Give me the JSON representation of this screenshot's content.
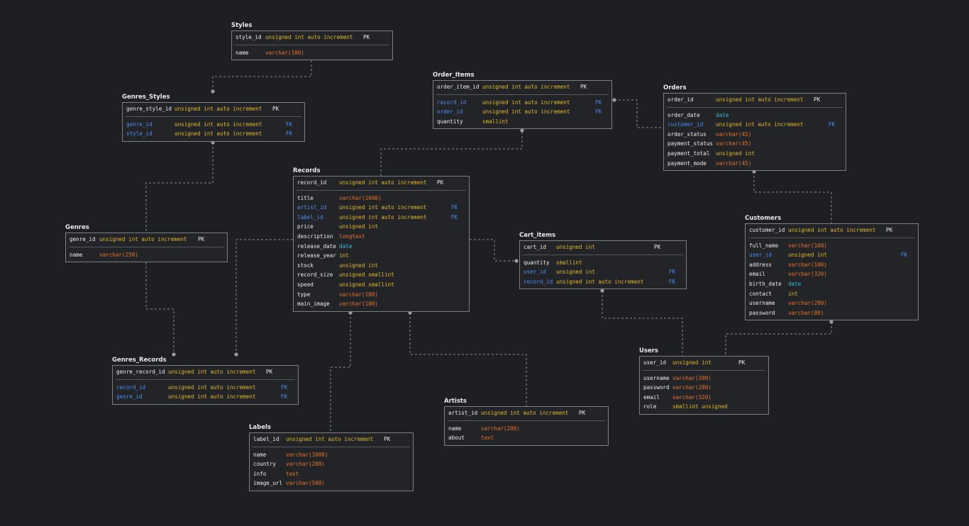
{
  "tables": [
    {
      "id": "styles",
      "name": "Styles",
      "rows": [
        {
          "name": "style_id",
          "type": "unsigned int auto increment",
          "key": "PK",
          "t": "yel",
          "k": "pk"
        },
        {
          "sep": true
        },
        {
          "name": "name",
          "type": "varchar(100)",
          "key": "",
          "t": "ora",
          "k": "reg"
        }
      ]
    },
    {
      "id": "genres_styles",
      "name": "Genres_Styles",
      "rows": [
        {
          "name": "genre_style_id",
          "type": "unsigned int auto increment",
          "key": "PK",
          "t": "yel",
          "k": "pk"
        },
        {
          "sep": true
        },
        {
          "name": "genre_id",
          "type": "unsigned int auto increment",
          "key": "FK",
          "t": "yel",
          "k": "fk"
        },
        {
          "name": "style_id",
          "type": "unsigned int auto increment",
          "key": "FK",
          "t": "yel",
          "k": "fk"
        }
      ]
    },
    {
      "id": "genres",
      "name": "Genres",
      "rows": [
        {
          "name": "genre_id",
          "type": "unsigned int auto increment",
          "key": "PK",
          "t": "yel",
          "k": "pk"
        },
        {
          "sep": true
        },
        {
          "name": "name",
          "type": "varchar(250)",
          "key": "",
          "t": "ora",
          "k": "reg"
        }
      ]
    },
    {
      "id": "genres_records",
      "name": "Genres_Records",
      "rows": [
        {
          "name": "genre_record_id",
          "type": "unsigned int auto increment",
          "key": "PK",
          "t": "yel",
          "k": "pk"
        },
        {
          "sep": true
        },
        {
          "name": "record_id",
          "type": "unsigned int auto increment",
          "key": "FK",
          "t": "yel",
          "k": "fk"
        },
        {
          "name": "genre_id",
          "type": "unsigned int auto increment",
          "key": "FK",
          "t": "yel",
          "k": "fk"
        }
      ]
    },
    {
      "id": "records",
      "name": "Records",
      "rows": [
        {
          "name": "record_id",
          "type": "unsigned int auto increment",
          "key": "PK",
          "t": "yel",
          "k": "pk"
        },
        {
          "sep": true
        },
        {
          "name": "title",
          "type": "varchar(1000)",
          "key": "",
          "t": "ora",
          "k": "reg"
        },
        {
          "name": "artist_id",
          "type": "unsigned int auto increment",
          "key": "FK",
          "t": "yel",
          "k": "fk"
        },
        {
          "name": "label_id",
          "type": "unsigned int auto increment",
          "key": "FK",
          "t": "yel",
          "k": "fk"
        },
        {
          "name": "price",
          "type": "unsigned int",
          "key": "",
          "t": "yel",
          "k": "reg"
        },
        {
          "name": "description",
          "type": "longtext",
          "key": "",
          "t": "ora",
          "k": "reg"
        },
        {
          "name": "release_date",
          "type": "date",
          "key": "",
          "t": "cya",
          "k": "reg"
        },
        {
          "name": "release_year",
          "type": "int",
          "key": "",
          "t": "yel",
          "k": "reg"
        },
        {
          "name": "stock",
          "type": "unsigned int",
          "key": "",
          "t": "yel",
          "k": "reg"
        },
        {
          "name": "record_size",
          "type": "unsigned smallint",
          "key": "",
          "t": "yel",
          "k": "reg"
        },
        {
          "name": "speed",
          "type": "unsigned smallint",
          "key": "",
          "t": "yel",
          "k": "reg"
        },
        {
          "name": "type",
          "type": "varchar(100)",
          "key": "",
          "t": "ora",
          "k": "reg"
        },
        {
          "name": "main_image",
          "type": "varchar(100)",
          "key": "",
          "t": "ora",
          "k": "reg"
        }
      ]
    },
    {
      "id": "labels",
      "name": "Labels",
      "rows": [
        {
          "name": "label_id",
          "type": "unsigned int auto increment",
          "key": "PK",
          "t": "yel",
          "k": "pk"
        },
        {
          "sep": true
        },
        {
          "name": "name",
          "type": "varchar(1000)",
          "key": "",
          "t": "ora",
          "k": "reg"
        },
        {
          "name": "country",
          "type": "varchar(200)",
          "key": "",
          "t": "ora",
          "k": "reg"
        },
        {
          "name": "info",
          "type": "text",
          "key": "",
          "t": "ora",
          "k": "reg"
        },
        {
          "name": "image_url",
          "type": "varchar(500)",
          "key": "",
          "t": "ora",
          "k": "reg"
        }
      ]
    },
    {
      "id": "artists",
      "name": "Artists",
      "rows": [
        {
          "name": "artist_id",
          "type": "unsigned int auto increment",
          "key": "PK",
          "t": "yel",
          "k": "pk"
        },
        {
          "sep": true
        },
        {
          "name": "name",
          "type": "varchar(200)",
          "key": "",
          "t": "ora",
          "k": "reg"
        },
        {
          "name": "about",
          "type": "text",
          "key": "",
          "t": "ora",
          "k": "reg"
        }
      ]
    },
    {
      "id": "order_items",
      "name": "Order_Items",
      "rows": [
        {
          "name": "order_item_id",
          "type": "unsigned int auto increment",
          "key": "PK",
          "t": "yel",
          "k": "pk"
        },
        {
          "sep": true
        },
        {
          "name": "record_id",
          "type": "unsigned int auto increment",
          "key": "FK",
          "t": "yel",
          "k": "fk"
        },
        {
          "name": "order_id",
          "type": "unsigned int auto increment",
          "key": "FK",
          "t": "yel",
          "k": "fk"
        },
        {
          "name": "quantity",
          "type": "smallint",
          "key": "",
          "t": "yel",
          "k": "reg"
        }
      ]
    },
    {
      "id": "orders",
      "name": "Orders",
      "rows": [
        {
          "name": "order_id",
          "type": "unsigned int auto increment",
          "key": "PK",
          "t": "yel",
          "k": "pk"
        },
        {
          "sep": true
        },
        {
          "name": "order_date",
          "type": "date",
          "key": "",
          "t": "cya",
          "k": "reg"
        },
        {
          "name": "customer_id",
          "type": "unsigned int auto increment",
          "key": "FK",
          "t": "yel",
          "k": "fk"
        },
        {
          "name": "order_status",
          "type": "varchar(45)",
          "key": "",
          "t": "ora",
          "k": "reg"
        },
        {
          "name": "payment_status",
          "type": "varchar(45)",
          "key": "",
          "t": "ora",
          "k": "reg"
        },
        {
          "name": "payment_total",
          "type": "unsigned int",
          "key": "",
          "t": "yel",
          "k": "reg"
        },
        {
          "name": "payment_mode",
          "type": "varchar(45)",
          "key": "",
          "t": "ora",
          "k": "reg"
        }
      ]
    },
    {
      "id": "cart_items",
      "name": "Cart_items",
      "rows": [
        {
          "name": "cart_id",
          "type": "unsigned int",
          "key": "PK",
          "t": "yel",
          "k": "pk"
        },
        {
          "sep": true
        },
        {
          "name": "quantity",
          "type": "smallint",
          "key": "",
          "t": "yel",
          "k": "reg"
        },
        {
          "name": "user_id",
          "type": "unsigned int",
          "key": "FK",
          "t": "yel",
          "k": "fk"
        },
        {
          "name": "record_id",
          "type": "unsigned int auto increment",
          "key": "FK",
          "t": "yel",
          "k": "fk"
        }
      ]
    },
    {
      "id": "customers",
      "name": "Customers",
      "rows": [
        {
          "name": "customer_id",
          "type": "unsigned int auto increment",
          "key": "PK",
          "t": "yel",
          "k": "pk"
        },
        {
          "sep": true
        },
        {
          "name": "full_name",
          "type": "varchar(100)",
          "key": "",
          "t": "ora",
          "k": "reg"
        },
        {
          "name": "user_id",
          "type": "unsigned int",
          "key": "FK",
          "t": "yel",
          "k": "fk"
        },
        {
          "name": "address",
          "type": "varchar(100)",
          "key": "",
          "t": "ora",
          "k": "reg"
        },
        {
          "name": "email",
          "type": "varchar(320)",
          "key": "",
          "t": "ora",
          "k": "reg"
        },
        {
          "name": "birth_date",
          "type": "date",
          "key": "",
          "t": "cya",
          "k": "reg"
        },
        {
          "name": "contact",
          "type": "int",
          "key": "",
          "t": "yel",
          "k": "reg"
        },
        {
          "name": "username",
          "type": "varchar(200)",
          "key": "",
          "t": "ora",
          "k": "reg"
        },
        {
          "name": "password",
          "type": "varchar(80)",
          "key": "",
          "t": "ora",
          "k": "reg"
        }
      ]
    },
    {
      "id": "users",
      "name": "Users",
      "rows": [
        {
          "name": "user_id",
          "type": "unsigned int",
          "key": "PK",
          "t": "yel",
          "k": "pk"
        },
        {
          "sep": true
        },
        {
          "name": "username",
          "type": "varchar(200)",
          "key": "",
          "t": "ora",
          "k": "reg"
        },
        {
          "name": "password",
          "type": "varchar(200)",
          "key": "",
          "t": "ora",
          "k": "reg"
        },
        {
          "name": "email",
          "type": "varchar(320)",
          "key": "",
          "t": "ora",
          "k": "reg"
        },
        {
          "name": "role",
          "type": "smallint unsigned",
          "key": "",
          "t": "yel",
          "k": "reg"
        }
      ]
    }
  ]
}
